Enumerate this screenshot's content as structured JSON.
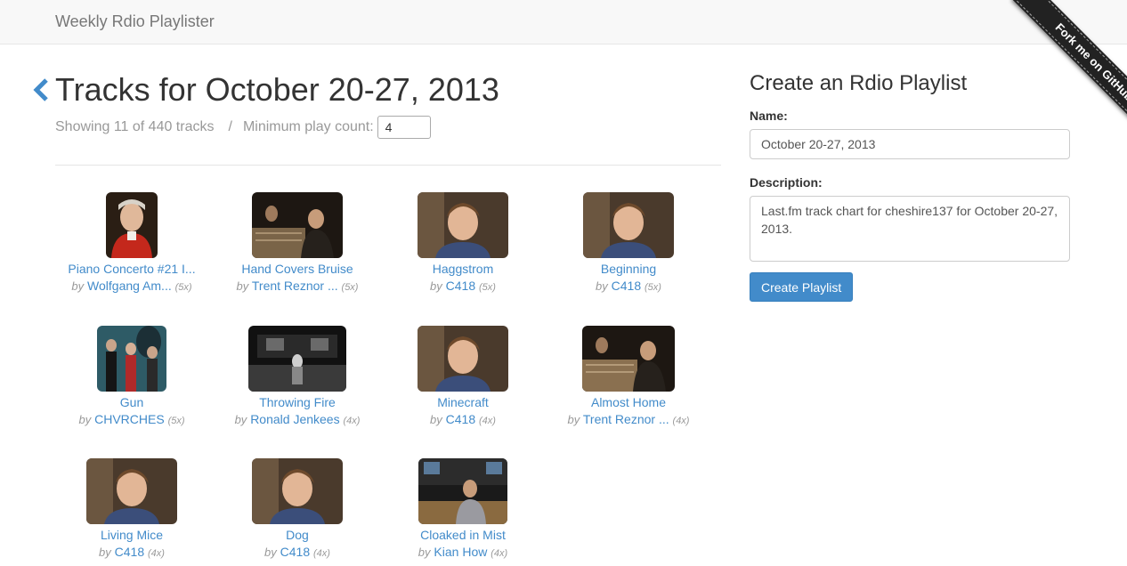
{
  "app": {
    "brand": "Weekly Rdio Playlister"
  },
  "ribbon": {
    "label": "Fork me on GitHub"
  },
  "header": {
    "title": "Tracks for October 20-27, 2013",
    "showing": "Showing 11 of 440 tracks",
    "separator": "/",
    "min_label": "Minimum play count:",
    "min_value": "4"
  },
  "tracks": [
    {
      "title": "Piano Concerto #21 I...",
      "by": "by",
      "artist": "Wolfgang Am...",
      "count": "(5x)",
      "art": "portrait-red-coat"
    },
    {
      "title": "Hand Covers Bruise",
      "by": "by",
      "artist": "Trent Reznor ...",
      "count": "(5x)",
      "art": "studio-dark"
    },
    {
      "title": "Haggstrom",
      "by": "by",
      "artist": "C418",
      "count": "(5x)",
      "art": "young-man-portrait"
    },
    {
      "title": "Beginning",
      "by": "by",
      "artist": "C418",
      "count": "(5x)",
      "art": "young-man-portrait"
    },
    {
      "title": "Gun",
      "by": "by",
      "artist": "CHVRCHES",
      "count": "(5x)",
      "art": "band-photo"
    },
    {
      "title": "Throwing Fire",
      "by": "by",
      "artist": "Ronald Jenkees",
      "count": "(4x)",
      "art": "studio-dark"
    },
    {
      "title": "Minecraft",
      "by": "by",
      "artist": "C418",
      "count": "(4x)",
      "art": "young-man-portrait"
    },
    {
      "title": "Almost Home",
      "by": "by",
      "artist": "Trent Reznor ...",
      "count": "(4x)",
      "art": "studio-dark"
    },
    {
      "title": "Living Mice",
      "by": "by",
      "artist": "C418",
      "count": "(4x)",
      "art": "young-man-portrait"
    },
    {
      "title": "Dog",
      "by": "by",
      "artist": "C418",
      "count": "(4x)",
      "art": "young-man-portrait"
    },
    {
      "title": "Cloaked in Mist",
      "by": "by",
      "artist": "Kian How",
      "count": "(4x)",
      "art": "studio-console"
    }
  ],
  "sidebar": {
    "title": "Create an Rdio Playlist",
    "name_label": "Name:",
    "name_value": "October 20-27, 2013",
    "desc_label": "Description:",
    "desc_value": "Last.fm track chart for cheshire137 for October 20-27, 2013.",
    "button": "Create Playlist"
  },
  "colors": {
    "link": "#428bca",
    "button": "#428bca",
    "muted": "#999999"
  }
}
